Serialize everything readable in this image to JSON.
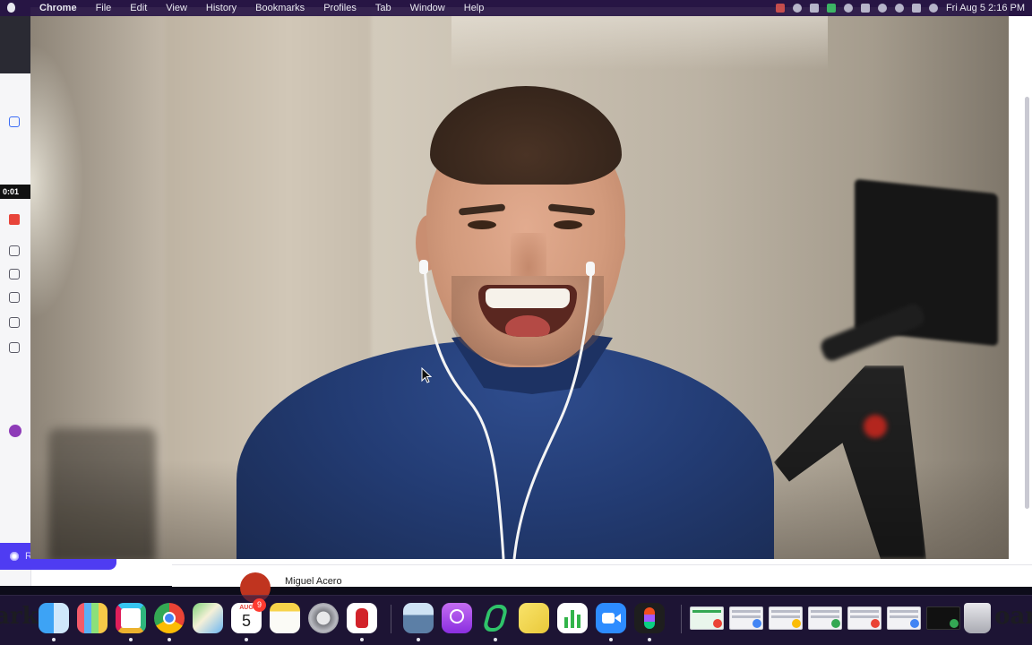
{
  "menubar": {
    "app_name": "Chrome",
    "items": [
      "File",
      "Edit",
      "View",
      "History",
      "Bookmarks",
      "Profiles",
      "Tab",
      "Window",
      "Help"
    ],
    "clock": "Fri Aug 5 2:16 PM"
  },
  "browser": {
    "recording_timer": "0:01",
    "record_button_label": "Record a video",
    "user_name": "Miguel Acero"
  },
  "dock": {
    "edge_left_text": "ark",
    "edge_right_text": "oar",
    "calendar_month": "AUG",
    "calendar_day": "5",
    "calendar_badge": "9",
    "apps": [
      "finder",
      "launchpad",
      "slack",
      "chrome",
      "maps",
      "calendar",
      "notes",
      "system-settings",
      "hand-app",
      "preview",
      "podcasts",
      "spring-app",
      "stickies",
      "numbers",
      "zoom",
      "figma"
    ]
  },
  "colors": {
    "record_accent": "#4f3cf2",
    "stop_red": "#e8443a",
    "shirt_navy": "#233c74"
  }
}
